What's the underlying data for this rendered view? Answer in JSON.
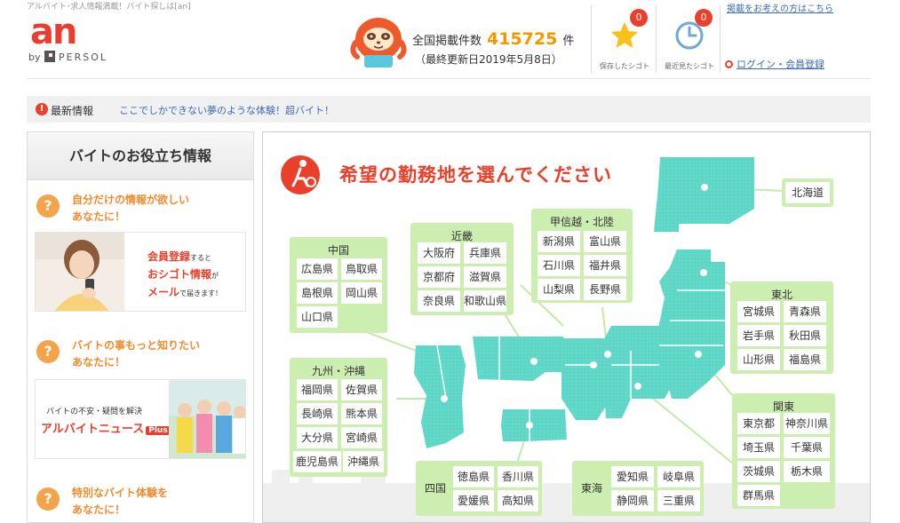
{
  "header": {
    "tagline": "アルバイト･求人情報満載！バイト探しは[an]",
    "logo_text": "an",
    "logo_by": "by",
    "logo_brand": "PERSOL",
    "count_prefix": "全国掲載件数",
    "count_value": "415725",
    "count_suffix": "件",
    "updated": "（最終更新日2019年5月8日）",
    "saved": {
      "badge": "0",
      "label": "保存したシゴト",
      "icon": "star-icon"
    },
    "viewed": {
      "badge": "0",
      "label": "最近見たシゴト",
      "icon": "clock-icon"
    },
    "post_link": "掲載をお考えの方はこちら",
    "login_link": "ログイン・会員登録"
  },
  "news": {
    "label": "最新情報",
    "text": "ここでしかできない夢のような体験！超バイト！"
  },
  "sidebar": {
    "title": "バイトのお役立ち情報",
    "sections": [
      {
        "line1": "自分だけの情報が欲しい",
        "line2": "あなたに！",
        "banner": {
          "a": "会員登録",
          "b": "すると",
          "c": "おシゴト情報",
          "d": "が",
          "e": "メール",
          "f": "で届きます！"
        }
      },
      {
        "line1": "バイトの事もっと知りたい",
        "line2": "あなたに！",
        "banner": {
          "a": "バイトの不安・疑問を解決",
          "b": "アルバイトニュース",
          "c": "Plus"
        }
      },
      {
        "line1": "特別なバイト体験を",
        "line2": "あなたに！"
      }
    ]
  },
  "map": {
    "title": "希望の勤務地を選んでください",
    "colors": {
      "land": "#5cd6c6",
      "region_box": "#cdeeb1",
      "accent": "#e9402c"
    },
    "regions": {
      "hokkaido": {
        "prefs": [
          "北海道"
        ]
      },
      "tohoku": {
        "name": "東北",
        "prefs": [
          "宮城県",
          "青森県",
          "岩手県",
          "秋田県",
          "山形県",
          "福島県"
        ]
      },
      "kanto": {
        "name": "関東",
        "prefs": [
          "東京都",
          "神奈川県",
          "埼玉県",
          "千葉県",
          "茨城県",
          "栃木県",
          "群馬県"
        ]
      },
      "koshinetsu": {
        "name": "甲信越・北陸",
        "prefs": [
          "新潟県",
          "富山県",
          "石川県",
          "福井県",
          "山梨県",
          "長野県"
        ]
      },
      "kinki": {
        "name": "近畿",
        "prefs": [
          "大阪府",
          "兵庫県",
          "京都府",
          "滋賀県",
          "奈良県",
          "和歌山県"
        ]
      },
      "chugoku": {
        "name": "中国",
        "prefs": [
          "広島県",
          "鳥取県",
          "島根県",
          "岡山県",
          "山口県"
        ]
      },
      "kyushu": {
        "name": "九州・沖縄",
        "prefs": [
          "福岡県",
          "佐賀県",
          "長崎県",
          "熊本県",
          "大分県",
          "宮崎県",
          "鹿児島県",
          "沖縄県"
        ]
      },
      "shikoku": {
        "name": "四国",
        "prefs": [
          "徳島県",
          "香川県",
          "愛媛県",
          "高知県"
        ]
      },
      "tokai": {
        "name": "東海",
        "prefs": [
          "愛知県",
          "岐阜県",
          "静岡県",
          "三重県"
        ]
      }
    }
  }
}
